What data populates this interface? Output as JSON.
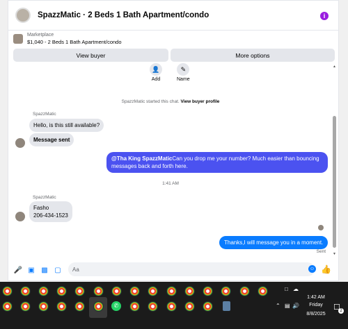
{
  "header": {
    "title": "SpazzMatic · 2 Beds 1 Bath Apartment/condo",
    "info_icon": "i"
  },
  "listing": {
    "label": "Marketplace",
    "title": "$1,040 - 2 Beds 1 Bath Apartment/condo"
  },
  "actions": {
    "view_buyer": "View buyer",
    "more_options": "More options"
  },
  "quick_actions": [
    {
      "label": "Add",
      "icon": "add-person-icon"
    },
    {
      "label": "Name",
      "icon": "pencil-icon"
    }
  ],
  "system": {
    "started_text": "SpazzMatic started this chat.",
    "view_profile_link": "View buyer profile"
  },
  "messages": [
    {
      "sender": "SpazzMatic",
      "text": "Hello, is this still available?"
    },
    {
      "text": "Message sent"
    },
    {
      "mention": "@Tha King SpazzMatic",
      "text": "Can you drop me your number? Much easier than bouncing",
      "text2": "messages back and forth here."
    },
    {
      "timestamp": "1:41 AM"
    },
    {
      "sender": "SpazzMatic",
      "text": "Fasho",
      "text2": "206-434-1523"
    },
    {
      "text": "Thanks,I will message you in a moment.",
      "status": "Sent"
    }
  ],
  "composer": {
    "placeholder": "Aa",
    "icons": [
      "microphone-icon",
      "gallery-icon",
      "sticker-icon",
      "gif-icon",
      "emoji-icon",
      "thumbs-up-icon"
    ]
  },
  "taskbar": {
    "time": "1:42 AM",
    "day": "Friday",
    "date": "8/8/2025",
    "notification_count": "2"
  },
  "colors": {
    "accent": "#0a7cff",
    "outgoing_bubble": "#4b52f0",
    "incoming_bubble": "#e4e6eb",
    "info_badge": "#9a1de0"
  }
}
